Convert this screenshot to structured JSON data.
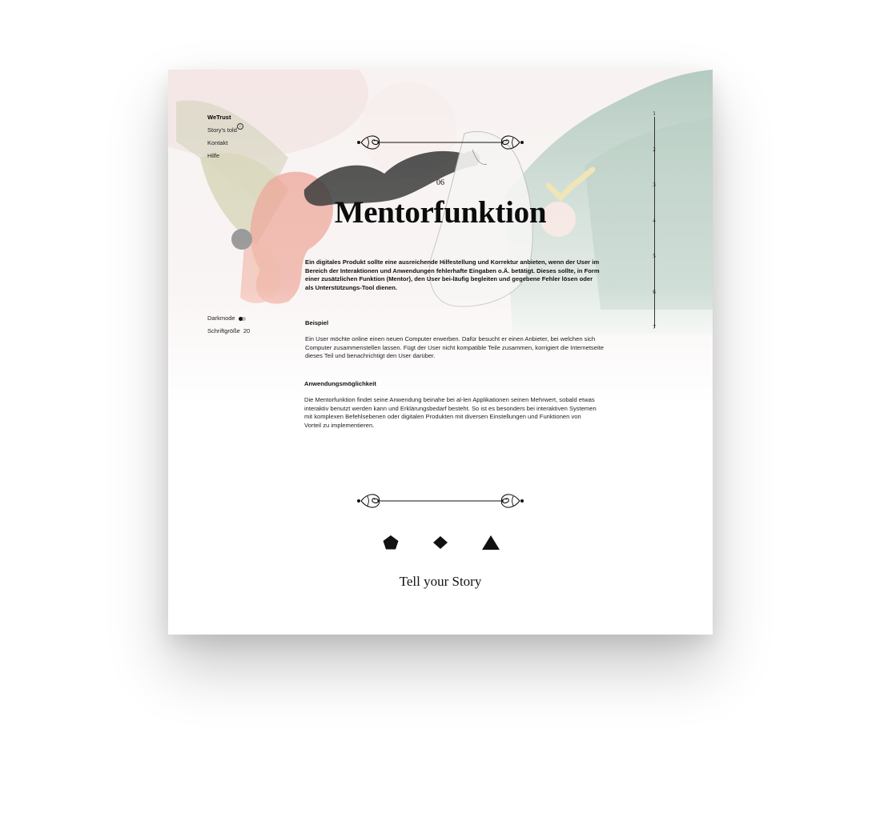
{
  "nav": {
    "items": [
      {
        "label": "WeTrust",
        "active": true
      },
      {
        "label": "Story's told",
        "badge": "i"
      },
      {
        "label": "Kontakt"
      },
      {
        "label": "Hilfe"
      }
    ]
  },
  "settings": {
    "darkmode_label": "Darkmode",
    "darkmode_on": false,
    "fontsize_label": "Schriftgröße",
    "fontsize_value": "20"
  },
  "progress": {
    "chapters": [
      "1",
      "2",
      "3",
      "4",
      "5",
      "6",
      "7"
    ]
  },
  "chapter": {
    "number": "06",
    "title": "Mentorfunktion",
    "intro": "Ein digitales Produkt sollte eine ausreichende Hilfestellung und Korrektur anbieten, wenn der User im Bereich der Interaktionen und Anwendungen fehlerhafte Eingaben o.Ä. betätigt. Dieses sollte, in Form einer zusätzlichen Funktion (Mentor), den User bei-läufig begleiten und gegebene Fehler lösen oder als Unterstützungs-Tool dienen.",
    "example_heading": "Beispiel",
    "example_text": "Ein User möchte online einen neuen Computer erwerben. Dafür besucht er einen Anbieter, bei welchen sich Computer zusammenstellen lassen. Fügt der User nicht kompatible Teile zusammen, korrigiert die Internetseite dieses Teil und benachrichtigt den User darüber.",
    "usage_heading": "Anwendungsmöglichkeit",
    "usage_text": "Die Mentorfunktion findet seine Anwendung beinahe bei al-len Applikationen seinen Mehrwert, sobald etwas interaktiv benutzt werden kann und Erklärungsbedarf besteht. So ist es besonders bei interaktiven Systemen mit komplexen Befehlsebenen oder digitalen Produkten mit diversen Einstellungen und Funktionen von Vorteil zu implementieren."
  },
  "footer": {
    "shapes": [
      "pentagon-icon",
      "diamond-icon",
      "triangle-icon"
    ],
    "cta": "Tell your Story"
  },
  "colors": {
    "text": "#111111",
    "accent_green": "#9bbcae",
    "accent_red": "#e8a89a",
    "accent_yellow": "#efe3b0"
  }
}
